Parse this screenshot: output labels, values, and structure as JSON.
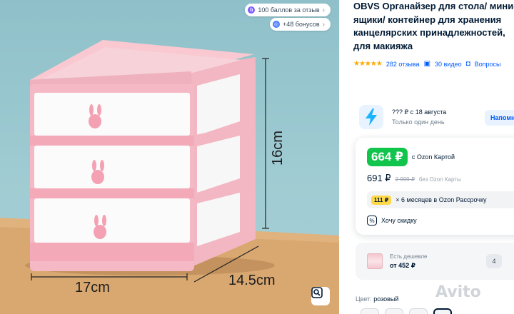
{
  "photo": {
    "dims": {
      "height": "16cm",
      "width": "17cm",
      "depth": "14.5cm"
    },
    "badges": [
      {
        "text": "100 баллов за отзыв",
        "icon": "points-icon"
      },
      {
        "text": "+48 бонусов",
        "icon": "bonus-icon"
      }
    ],
    "search_icon": "image-search-icon"
  },
  "product": {
    "title": "OBVS Органайзер для стола/ мини-ящики/ контейнер для хранения канцелярских принадлежностей, для макияжа",
    "rating_stars": "★★★★★",
    "reviews": "282 отзыва",
    "videos": "30 видео",
    "questions": "Вопросы"
  },
  "delivery": {
    "line1": "??? ₽ с 18 августа",
    "line2": "Только один день",
    "remind_label": "Напомнить"
  },
  "price": {
    "ozon_price": "664 ₽",
    "ozon_label": "с Ozon Картой",
    "regular_price": "691 ₽",
    "old_price": "2 999 ₽",
    "no_card_label": "без Ozon Карты",
    "installment_badge": "111 ₽",
    "installment_text": "× 6 месяцев в Ozon Рассрочку",
    "discount_label": "Хочу скидку"
  },
  "cheaper": {
    "label": "Есть дешевле",
    "price": "от 452 ₽",
    "count": "4"
  },
  "color": {
    "label": "Цвет:",
    "value": "розовый"
  },
  "watermark": "Avito",
  "colors": {
    "accent": "#005bff",
    "ozon_green": "#10c44c",
    "star": "#ffa800"
  }
}
